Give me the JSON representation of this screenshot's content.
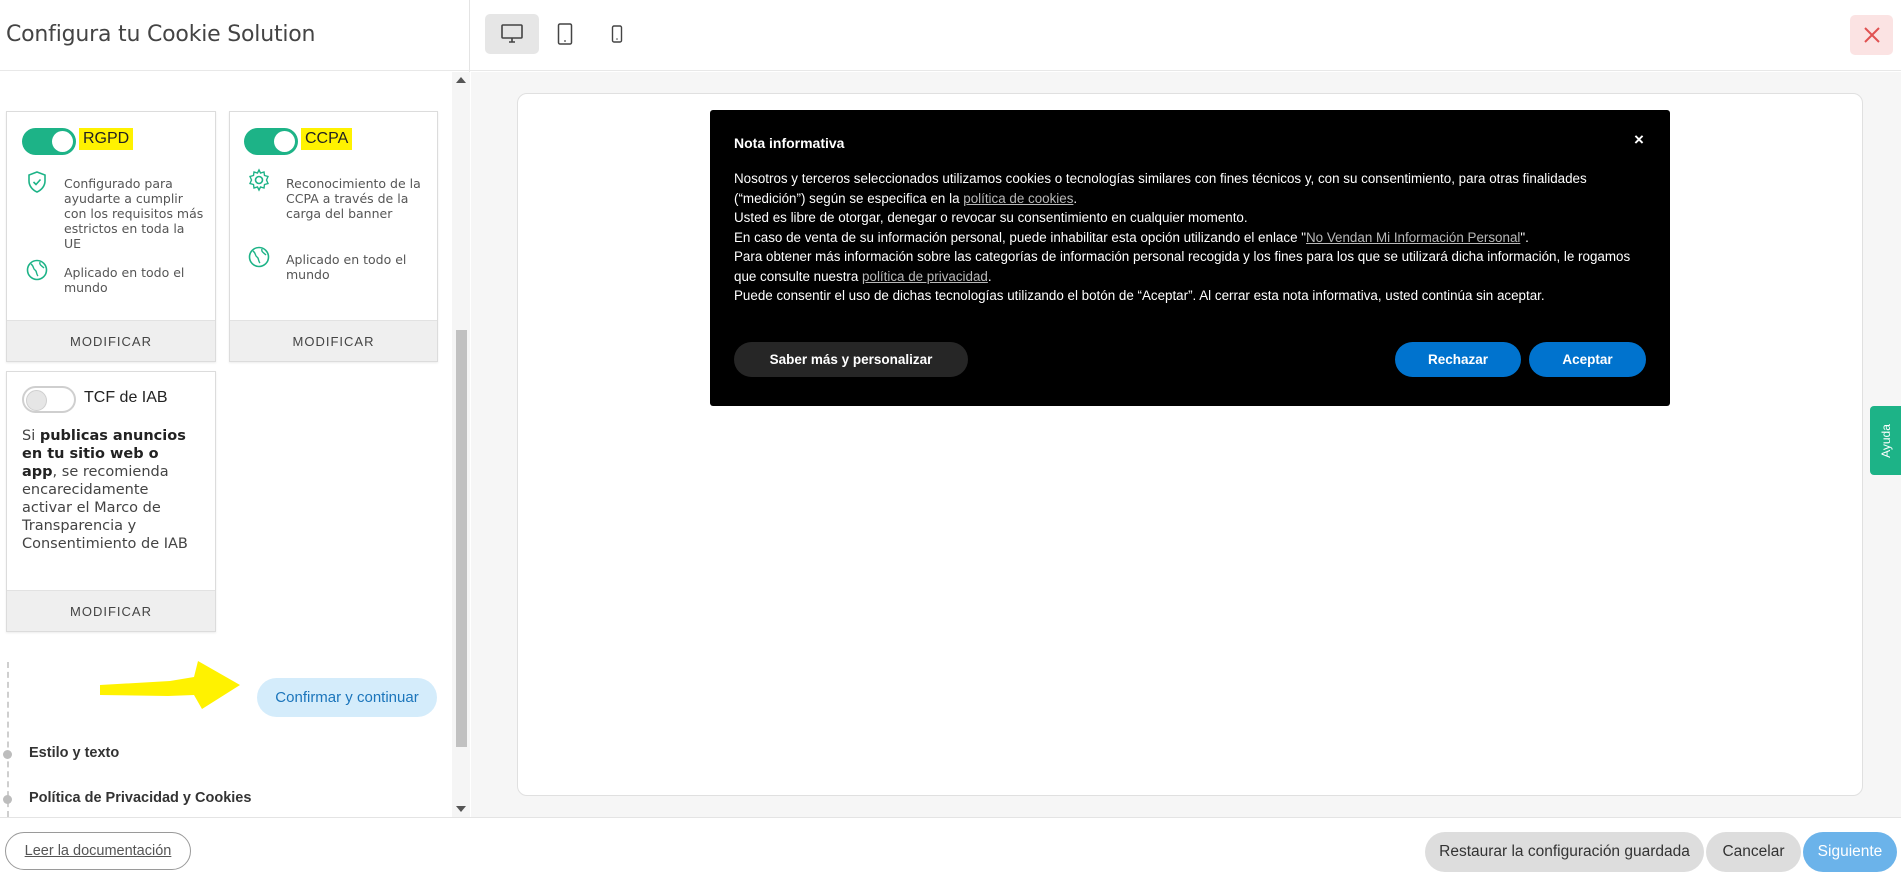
{
  "panel": {
    "title": "Configura tu Cookie Solution"
  },
  "cards": {
    "rgpd": {
      "law": "RGPD",
      "enabled": true,
      "feature1": "Configurado para ayudarte a cumplir con los requisitos más estrictos en toda la UE",
      "feature2": "Aplicado en todo el mundo",
      "modify": "MODIFICAR"
    },
    "ccpa": {
      "law": "CCPA",
      "enabled": true,
      "feature1": "Reconocimiento de la CCPA a través de la carga del banner",
      "feature2": "Aplicado en todo el mundo",
      "modify": "MODIFICAR"
    },
    "tcf": {
      "law": "TCF de IAB",
      "enabled": false,
      "text_prefix": "Si ",
      "text_bold": "publicas anuncios en tu sitio web o app",
      "text_suffix": ", se recomienda encarecidamente activar el Marco de Transparencia y Consentimiento de IAB",
      "modify": "MODIFICAR"
    }
  },
  "confirm_button": "Confirmar y continuar",
  "steps": [
    {
      "label": "Estilo y texto"
    },
    {
      "label": "Política de Privacidad y Cookies"
    }
  ],
  "devices": [
    "desktop-icon",
    "tablet-icon",
    "mobile-icon"
  ],
  "banner": {
    "title": "Nota informativa",
    "close": "×",
    "p1_a": "Nosotros y terceros seleccionados utilizamos cookies o tecnologías similares con fines técnicos y, con su consentimiento, para otras finalidades (“medición”) según se especifica en la ",
    "p1_link": "política de cookies",
    "p1_b": ".",
    "p2": "Usted es libre de otorgar, denegar o revocar su consentimiento en cualquier momento.",
    "p3_a": "En caso de venta de su información personal, puede inhabilitar esta opción utilizando el enlace \"",
    "p3_link": "No Vendan Mi Información Personal",
    "p3_b": "\".",
    "p4_a": "Para obtener más información sobre las categorías de información personal recogida y los fines para los que se utilizará dicha información, le rogamos que consulte nuestra ",
    "p4_link": "política de privacidad",
    "p4_b": ".",
    "p5": "Puede consentir el uso de dichas tecnologías utilizando el botón de “Aceptar”. Al cerrar esta nota informativa, usted continúa sin aceptar.",
    "learn_more": "Saber más y personalizar",
    "reject": "Rechazar",
    "accept": "Aceptar"
  },
  "help_tab": "Ayuda",
  "footer": {
    "docs": "Leer la documentación",
    "restore": "Restaurar la configuración guardada",
    "cancel": "Cancelar",
    "next": "Siguiente"
  },
  "colors": {
    "toggle_on": "#1db387",
    "highlight": "#fff200",
    "primary_button": "#0073ce",
    "next_button": "#6bb3ea",
    "close_bg": "#fbe3e3",
    "close_icon": "#e05252"
  }
}
